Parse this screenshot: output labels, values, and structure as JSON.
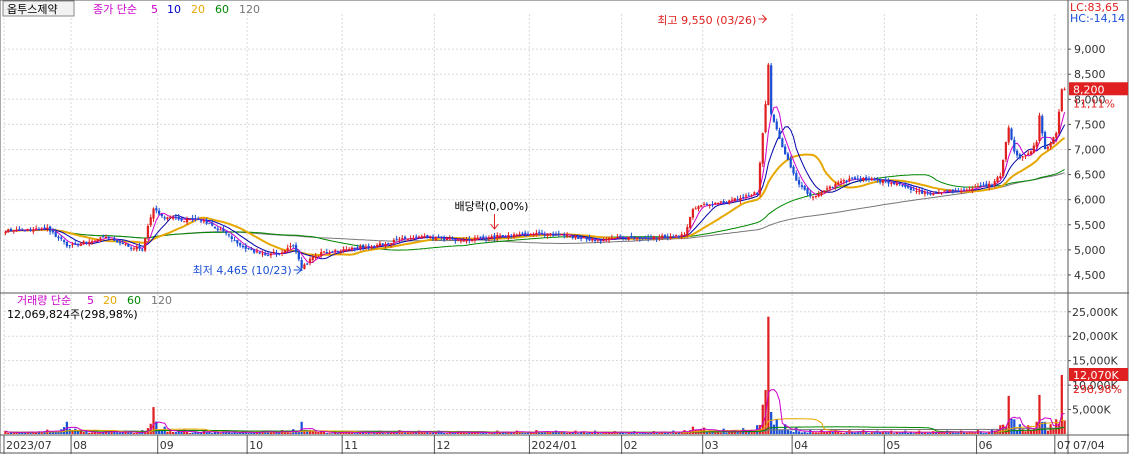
{
  "stock_name": "옵투스제약",
  "price_legend": {
    "label": "종가 단순",
    "periods": [
      {
        "text": "5",
        "color": "#cc00cc"
      },
      {
        "text": "10",
        "color": "#0000cc"
      },
      {
        "text": "20",
        "color": "#e6a800"
      },
      {
        "text": "60",
        "color": "#008800"
      },
      {
        "text": "120",
        "color": "#777777"
      }
    ]
  },
  "volume_legend": {
    "label": "거래량 단순",
    "periods": [
      {
        "text": "5",
        "color": "#cc00cc"
      },
      {
        "text": "20",
        "color": "#e6a800"
      },
      {
        "text": "60",
        "color": "#008800"
      },
      {
        "text": "120",
        "color": "#777777"
      }
    ],
    "current": "12,069,824주(298,98%)"
  },
  "lc_label": "LC:83,65",
  "hc_label": "HC:-14,14",
  "colors": {
    "up": "#e02020",
    "down": "#1a4fd6",
    "ma5": "#cc00cc",
    "ma10": "#0000aa",
    "ma20": "#e6a800",
    "ma60": "#008800",
    "ma120": "#777777",
    "grid": "#d8d8d8",
    "axis": "#555555"
  },
  "chart_data": {
    "type": "candlestick",
    "price_axis": {
      "ticks": [
        "4,500",
        "5,000",
        "5,500",
        "6,000",
        "6,500",
        "7,000",
        "7,500",
        "8,000",
        "8,500",
        "9,000"
      ],
      "ylim": [
        4200,
        9700
      ]
    },
    "volume_axis": {
      "ticks": [
        "5,000K",
        "10,000K",
        "15,000K",
        "20,000K",
        "25,000K"
      ],
      "ylim": [
        0,
        27000
      ]
    },
    "x_labels": [
      "2023/07",
      "08",
      "09",
      "10",
      "11",
      "12",
      "2024/01",
      "02",
      "03",
      "04",
      "05",
      "06",
      "07",
      "07/04"
    ],
    "annotations": {
      "high": "최고 9,550 (03/26)",
      "low": "최저 4,465 (10/23)",
      "dividend": "배당락(0,00%)"
    },
    "current_price": "8,200",
    "current_change": "11,11%",
    "current_volume": "12,070K",
    "current_volume_pct": "298,98%",
    "anchors": [
      [
        0,
        5380,
        600
      ],
      [
        15,
        5420,
        900
      ],
      [
        22,
        5100,
        2500
      ],
      [
        29,
        5150,
        700
      ],
      [
        36,
        5250,
        800
      ],
      [
        43,
        5100,
        700
      ],
      [
        49,
        5000,
        800
      ],
      [
        51,
        5450,
        1200
      ],
      [
        53,
        5800,
        5500
      ],
      [
        57,
        5650,
        1500
      ],
      [
        64,
        5600,
        900
      ],
      [
        71,
        5580,
        800
      ],
      [
        78,
        5350,
        700
      ],
      [
        85,
        5050,
        600
      ],
      [
        92,
        4900,
        700
      ],
      [
        99,
        4950,
        800
      ],
      [
        103,
        5100,
        1000
      ],
      [
        106,
        4650,
        2500
      ],
      [
        109,
        4800,
        800
      ],
      [
        113,
        4950,
        700
      ],
      [
        120,
        5000,
        600
      ],
      [
        127,
        5050,
        600
      ],
      [
        134,
        5100,
        700
      ],
      [
        141,
        5200,
        800
      ],
      [
        148,
        5250,
        700
      ],
      [
        155,
        5230,
        700
      ],
      [
        162,
        5180,
        600
      ],
      [
        169,
        5230,
        600
      ],
      [
        176,
        5270,
        700
      ],
      [
        183,
        5300,
        700
      ],
      [
        190,
        5330,
        800
      ],
      [
        197,
        5300,
        700
      ],
      [
        204,
        5250,
        700
      ],
      [
        211,
        5200,
        700
      ],
      [
        218,
        5230,
        600
      ],
      [
        225,
        5240,
        600
      ],
      [
        232,
        5250,
        600
      ],
      [
        239,
        5270,
        700
      ],
      [
        243,
        5300,
        800
      ],
      [
        246,
        5800,
        1500
      ],
      [
        250,
        5900,
        1300
      ],
      [
        257,
        5950,
        1100
      ],
      [
        264,
        6050,
        1200
      ],
      [
        269,
        6150,
        1800
      ],
      [
        271,
        7300,
        6000
      ],
      [
        272,
        7900,
        9000
      ],
      [
        273,
        8700,
        24000
      ],
      [
        274,
        7700,
        4500
      ],
      [
        276,
        7400,
        3000
      ],
      [
        279,
        6900,
        2000
      ],
      [
        283,
        6400,
        1300
      ],
      [
        288,
        6050,
        1000
      ],
      [
        292,
        6150,
        900
      ],
      [
        297,
        6300,
        900
      ],
      [
        302,
        6400,
        800
      ],
      [
        307,
        6420,
        800
      ],
      [
        312,
        6380,
        700
      ],
      [
        317,
        6330,
        700
      ],
      [
        322,
        6250,
        700
      ],
      [
        327,
        6150,
        700
      ],
      [
        332,
        6120,
        600
      ],
      [
        337,
        6160,
        700
      ],
      [
        342,
        6200,
        700
      ],
      [
        348,
        6250,
        800
      ],
      [
        353,
        6300,
        900
      ],
      [
        356,
        6500,
        1800
      ],
      [
        359,
        7450,
        7800
      ],
      [
        361,
        6950,
        3000
      ],
      [
        363,
        6800,
        2000
      ],
      [
        366,
        6900,
        1800
      ],
      [
        369,
        7150,
        2500
      ],
      [
        370,
        7650,
        8000
      ],
      [
        372,
        7000,
        2500
      ],
      [
        374,
        7150,
        2000
      ],
      [
        376,
        7300,
        3000
      ],
      [
        378,
        8200,
        12070
      ]
    ]
  }
}
